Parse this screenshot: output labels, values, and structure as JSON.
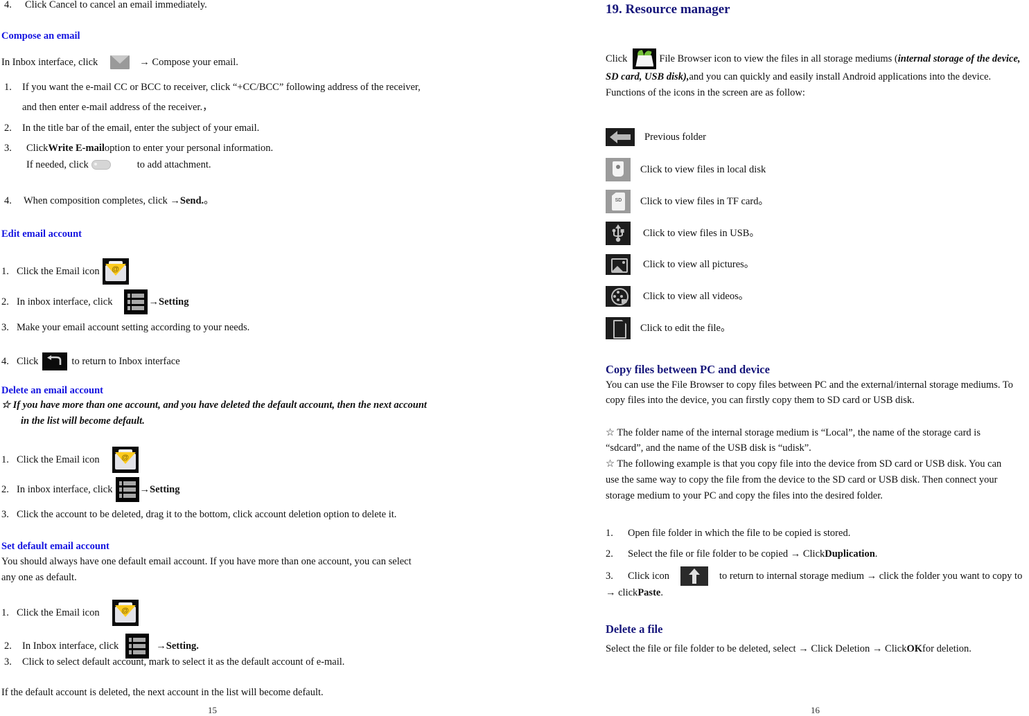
{
  "document": {
    "type": "user-manual-spread",
    "left_page_number": "15",
    "right_page_number": "16",
    "heading_color_left": "#1414e0",
    "heading_color_right": "#15157a"
  },
  "left_page": {
    "item4_top": {
      "number": "4.",
      "text": "Click Cancel to cancel an email immediately."
    },
    "compose": {
      "heading": "Compose an email",
      "intro_pre": "In Inbox interface, click",
      "intro_post": "→ Compose your email.",
      "steps": [
        {
          "number": "1.",
          "line1": "If you want the e-mail CC or BCC to receiver, click “+CC/BCC” following address of the receiver,",
          "line2": "and then enter e-mail address of the receiver.，"
        },
        {
          "number": "2.",
          "line1": "In the title bar of the email, enter the subject of your email."
        },
        {
          "number": "3.",
          "line1_pre": "Click ",
          "line1_bold": "Write E-mail",
          "line1_post": " option to enter your personal information.",
          "line2_pre": "If needed, click",
          "line2_post": "to add attachment."
        },
        {
          "number": "4.",
          "line1_pre": "When composition completes, click →",
          "line1_bold": "Send.",
          "line1_post": "。"
        }
      ]
    },
    "edit_account": {
      "heading": "Edit email account",
      "step1": {
        "number": "1.",
        "text": "Click the Email icon"
      },
      "step2": {
        "number": "2.",
        "pre": "In inbox interface, click",
        "post": "→Setting"
      },
      "step3": {
        "number": "3.",
        "text": "Make your email account setting according to your needs."
      },
      "step4": {
        "number": "4.",
        "pre": "Click",
        "post": "to return to Inbox interface"
      }
    },
    "delete_account": {
      "heading": "Delete an email account",
      "note_line1": "☆ If you have more than one account, and you have deleted the default account, then the next account",
      "note_line2": "in the list will become default.",
      "step1": {
        "number": "1.",
        "text": "Click the Email icon"
      },
      "step2": {
        "number": "2.",
        "pre": "In inbox interface, click",
        "post": "→Setting"
      },
      "step3": {
        "number": "3.",
        "text": "Click the account to be deleted, drag it to    the bottom, click account deletion option to delete it."
      }
    },
    "set_default": {
      "heading": "Set default email account",
      "para_line1": "You should always have one default email account. If you have more than one account, you can select",
      "para_line2": "any one as default.",
      "step1": {
        "number": "1.",
        "text": "Click the Email icon"
      },
      "step2": {
        "number": "2.",
        "pre": "In Inbox interface, click",
        "post": "→Setting."
      },
      "step3": {
        "number": "3.",
        "text": "Click to select default account, mark to select it as the default account of e-mail."
      },
      "closing": "If the default account is deleted, the next account in the list will become default."
    }
  },
  "right_page": {
    "title": "19. Resource manager",
    "intro": {
      "pre": "Click",
      "mid": "File Browser icon to view the files in all storage mediums (",
      "italic1": "internal storage of the device,",
      "italic2": "SD card, USB disk),",
      "post": " and you can quickly and easily install Android applications into the device.",
      "line3": "Functions of the icons in the screen are as follow:"
    },
    "icon_list": [
      {
        "icon": "previous-folder-icon",
        "label": "Previous folder"
      },
      {
        "icon": "local-disk-icon",
        "label": "Click to view files in local disk"
      },
      {
        "icon": "sd-card-icon",
        "label": "Click to view files in TF card。"
      },
      {
        "icon": "usb-icon",
        "label": "Click to view files in USB。"
      },
      {
        "icon": "picture-icon",
        "label": "Click to view all pictures。"
      },
      {
        "icon": "video-icon",
        "label": "Click to view all videos。"
      },
      {
        "icon": "file-edit-icon",
        "label": "Click to edit the file。"
      }
    ],
    "copy_files": {
      "heading": "Copy files between PC and device",
      "para_line1": "You can use the File Browser to copy files between PC and the external/internal storage mediums. To",
      "para_line2": "copy files into the device, you can firstly copy them to SD card or USB disk.",
      "bullet1_line1": "☆    The folder name of the internal storage medium is “Local”, the name of the storage card is",
      "bullet1_line2": "“sdcard”, and the name of the USB disk is “udisk”.",
      "bullet2_line1": "☆   The following example is that you copy file into the device from SD card or USB disk. You can",
      "bullet2_line2": "use the same way to copy the file from the device to the SD card or USB disk. Then connect your",
      "bullet2_line3": "storage medium to your PC and copy the files into the desired folder.",
      "steps": [
        {
          "number": "1.",
          "text": "Open file folder in which the file to be copied is stored."
        },
        {
          "number": "2.",
          "pre": "Select the file or file folder to be copied → Click ",
          "bold": "Duplication",
          "post": "."
        },
        {
          "number": "3.",
          "pre": "Click icon",
          "post": "to return to internal storage medium → click the folder you want to copy to",
          "line2_pre": "→ click ",
          "line2_bold": "Paste",
          "line2_post": "."
        }
      ]
    },
    "delete_file": {
      "heading": "Delete a file",
      "para_pre": "Select the file or file folder to be deleted, select → Click Deletion → Click ",
      "para_bold": "OK",
      "para_post": " for deletion."
    }
  }
}
